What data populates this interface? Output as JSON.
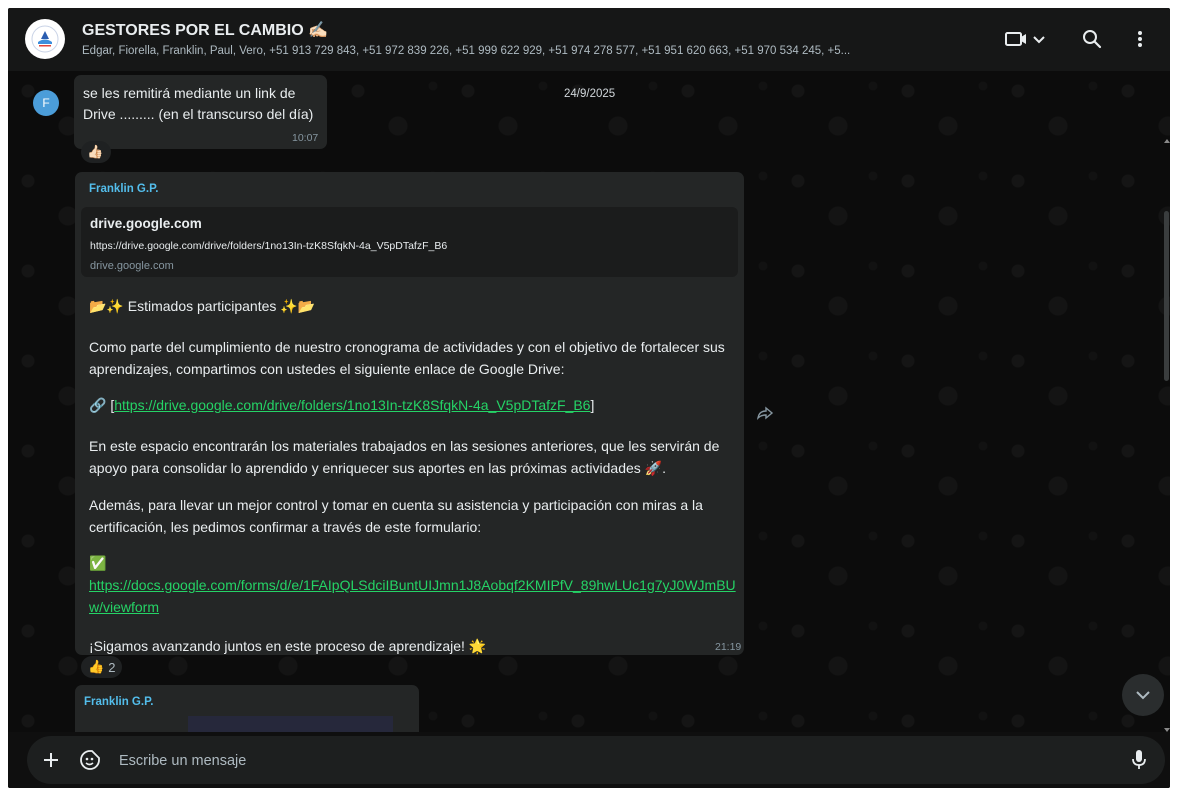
{
  "header": {
    "title": "GESTORES POR EL CAMBIO ✍🏻",
    "members": "Edgar, Fiorella, Franklin, Paul, Vero, +51 913 729 843, +51 972 839 226, +51 999 622 929, +51 974 278 577, +51 951 620 663, +51 970 534 245, +5...",
    "icons": [
      "video-call-icon",
      "chevron-down-icon",
      "search-icon",
      "menu-dots-icon"
    ]
  },
  "messages": {
    "m1": {
      "avatar_initial": "F",
      "text": "se les remitirá mediante un link de Drive ......... (en el transcurso del día)",
      "time": "10:07",
      "reaction": "👍🏻"
    },
    "date_chip": "24/9/2025",
    "m2": {
      "sender": "Franklin G.P.",
      "preview": {
        "title": "drive.google.com",
        "url": "https://drive.google.com/drive/folders/1no13In-tzK8SfqkN-4a_V5pDTafzF_B6",
        "domain": "drive.google.com"
      },
      "greeting": "📂✨ Estimados participantes ✨📂",
      "para1": "Como parte del cumplimiento de nuestro cronograma de actividades y con el objetivo de fortalecer sus aprendizajes, compartimos con ustedes el siguiente enlace de Google Drive:",
      "link_prefix": "🔗 [",
      "drive_link": "https://drive.google.com/drive/folders/1no13In-tzK8SfqkN-4a_V5pDTafzF_B6",
      "link_suffix": "]",
      "para2": "En este espacio encontrarán los materiales trabajados en las sesiones anteriores, que les servirán de apoyo para consolidar lo aprendido y enriquecer sus aportes en las próximas actividades 🚀.",
      "para3": "Además, para llevar un mejor control y tomar en cuenta su asistencia y participación con miras a la certificación, les pedimos confirmar a través de este formulario:",
      "check_emoji": "✅",
      "form_link": "https://docs.google.com/forms/d/e/1FAIpQLSdciIBuntUIJmn1J8Aobqf2KMIPfV_89hwLUc1g7yJ0WJmBUw/viewform",
      "closing": "¡Sigamos avanzando juntos en este proceso de aprendizaje! 🌟",
      "time": "21:19",
      "reaction_emoji": "👍",
      "reaction_count": "2"
    },
    "m3": {
      "sender": "Franklin G.P."
    }
  },
  "composer": {
    "placeholder": "Escribe un mensaje"
  }
}
